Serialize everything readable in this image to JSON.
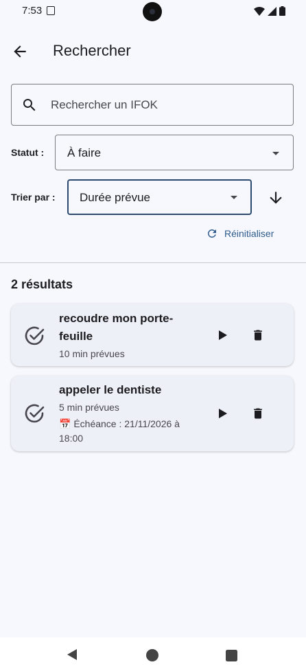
{
  "status_bar": {
    "time": "7:53"
  },
  "app_bar": {
    "title": "Rechercher"
  },
  "search": {
    "placeholder": "Rechercher un IFOK"
  },
  "filters": {
    "status_label": "Statut :",
    "status_value": "À faire",
    "sort_label": "Trier par :",
    "sort_value": "Durée prévue",
    "reset_label": "Réinitialiser"
  },
  "results": {
    "count_label": "2 résultats",
    "items": [
      {
        "title_line1": "recoudre mon porte-",
        "title_line2": "feuille",
        "duration": "10 min prévues"
      },
      {
        "title_line1": "appeler le dentiste",
        "duration": "5 min prévues",
        "due_line1": "📅 Échéance : 21/11/2026 à",
        "due_line2": "18:00"
      }
    ]
  },
  "colors": {
    "background": "#f7f8fd",
    "card": "#eef0f7",
    "accent": "#2c5a8c",
    "focused_border": "#2c4a6e"
  },
  "icons": {
    "back": "arrow-left-icon",
    "search": "search-icon",
    "sort_direction": "arrow-down-icon",
    "reset": "refresh-icon",
    "task_done": "check-circle-icon",
    "play": "play-icon",
    "delete": "trash-icon"
  }
}
